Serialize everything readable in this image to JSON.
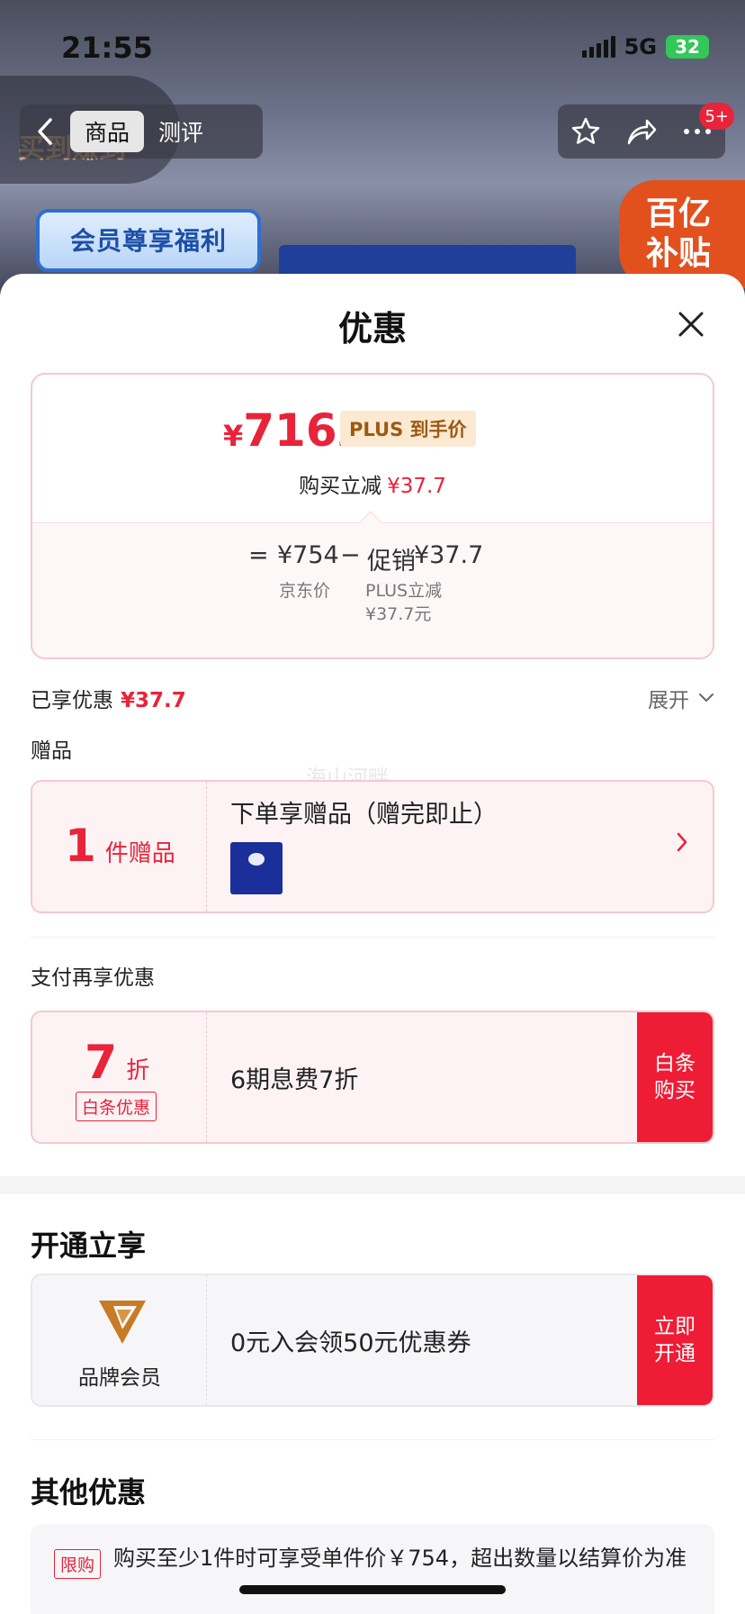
{
  "status_bar": {
    "time": "21:55",
    "network": "5G",
    "battery": "32"
  },
  "background": {
    "banner_text": "会员尊享福利",
    "logo_text": "买到赚到",
    "subsidy_badge_line1": "百亿",
    "subsidy_badge_line2": "补贴"
  },
  "nav": {
    "tabs": [
      "商品",
      "测评"
    ],
    "notification_count": "5+"
  },
  "sheet": {
    "title": "优惠",
    "price_card": {
      "currency": "¥",
      "price_int": "716",
      "price_dec": ".3",
      "plus_tag": "PLUS 到手价",
      "buy_reduce_label": "购买立减",
      "buy_reduce_value": "¥37.7",
      "equals": "=",
      "jd_price": "¥754",
      "jd_price_label": "京东价",
      "minus": "−",
      "promo_label": "促销",
      "promo_value": "¥37.7",
      "plus_reduce_line1": "PLUS立减",
      "plus_reduce_line2": "¥37.7元"
    },
    "enjoyed_label": "已享优惠",
    "enjoyed_value": "¥37.7",
    "expand_label": "展开",
    "gift_section_label": "赠品",
    "gift": {
      "count": "1",
      "unit": "件赠品",
      "text": "下单享赠品（赠完即止）"
    },
    "pay_section_label": "支付再享优惠",
    "payment_offer": {
      "discount": "7",
      "discount_unit": "折",
      "tag": "白条优惠",
      "text": "6期息费7折",
      "action": "白条购买"
    },
    "open_section_title": "开通立享",
    "member_offer": {
      "brand_label": "品牌会员",
      "text": "0元入会领50元优惠券",
      "action": "立即开通"
    },
    "other_section_title": "其他优惠",
    "limit_offer": {
      "tag": "限购",
      "text": "购买至少1件时可享受单件价￥754，超出数量以结算价为准"
    },
    "watermark": "海山河畔"
  },
  "colors": {
    "accent_red": "#ee1c35",
    "price_red": "#e8233a",
    "plus_tag_bg": "#fbe9d2",
    "plus_tag_text": "#9c5a12",
    "member_gold": "#c97a24"
  }
}
